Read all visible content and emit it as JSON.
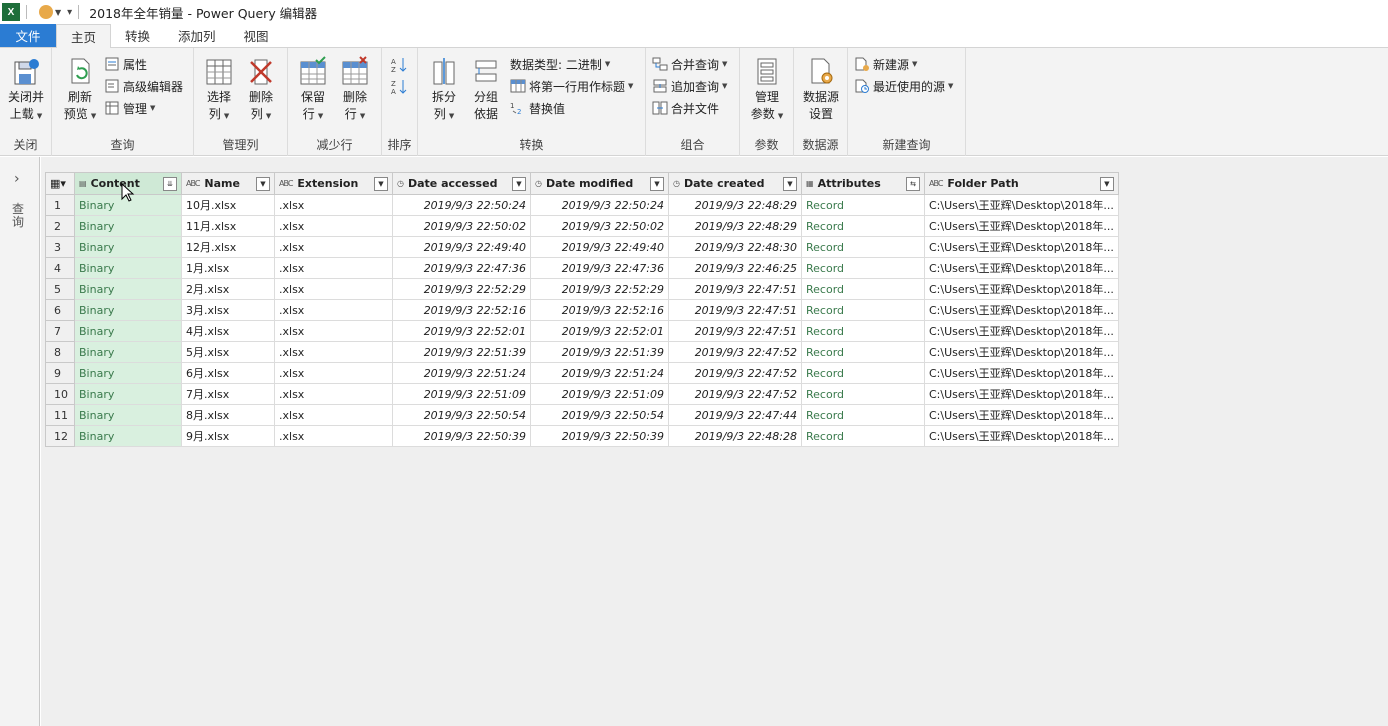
{
  "window": {
    "excel_icon": "X",
    "title": "2018年全年销量 - Power Query 编辑器"
  },
  "tabs": [
    "文件",
    "主页",
    "转换",
    "添加列",
    "视图"
  ],
  "ribbon": {
    "close": {
      "label1": "关闭并",
      "label2": "上载",
      "group": "关闭"
    },
    "query": {
      "refresh1": "刷新",
      "refresh2": "预览",
      "properties": "属性",
      "advanced_editor": "高级编辑器",
      "manage": "管理",
      "group": "查询"
    },
    "manage_columns": {
      "choose1": "选择",
      "choose2": "列",
      "remove1": "删除",
      "remove2": "列",
      "group": "管理列"
    },
    "reduce_rows": {
      "keep1": "保留",
      "keep2": "行",
      "remove1": "删除",
      "remove2": "行",
      "group": "减少行"
    },
    "sort": {
      "group": "排序"
    },
    "transform": {
      "split1": "拆分",
      "split2": "列",
      "groupby1": "分组",
      "groupby2": "依据",
      "data_type": "数据类型: 二进制",
      "first_row_header": "将第一行用作标题",
      "replace_values": "替换值",
      "group": "转换"
    },
    "combine": {
      "merge": "合并查询",
      "append": "追加查询",
      "combine_files": "合并文件",
      "group": "组合"
    },
    "parameters": {
      "manage1": "管理",
      "manage2": "参数",
      "group": "参数"
    },
    "datasource": {
      "settings1": "数据源",
      "settings2": "设置",
      "group": "数据源"
    },
    "new_query": {
      "new_source": "新建源",
      "recent_sources": "最近使用的源",
      "group": "新建查询"
    }
  },
  "nav": {
    "label": "查询"
  },
  "grid": {
    "columns": [
      "Content",
      "Name",
      "Extension",
      "Date accessed",
      "Date modified",
      "Date created",
      "Attributes",
      "Folder Path"
    ],
    "rows": [
      [
        "1",
        "Binary",
        "10月.xlsx",
        ".xlsx",
        "2019/9/3 22:50:24",
        "2019/9/3 22:50:24",
        "2019/9/3 22:48:29",
        "Record",
        "C:\\Users\\王亚辉\\Desktop\\2018年..."
      ],
      [
        "2",
        "Binary",
        "11月.xlsx",
        ".xlsx",
        "2019/9/3 22:50:02",
        "2019/9/3 22:50:02",
        "2019/9/3 22:48:29",
        "Record",
        "C:\\Users\\王亚辉\\Desktop\\2018年..."
      ],
      [
        "3",
        "Binary",
        "12月.xlsx",
        ".xlsx",
        "2019/9/3 22:49:40",
        "2019/9/3 22:49:40",
        "2019/9/3 22:48:30",
        "Record",
        "C:\\Users\\王亚辉\\Desktop\\2018年..."
      ],
      [
        "4",
        "Binary",
        "1月.xlsx",
        ".xlsx",
        "2019/9/3 22:47:36",
        "2019/9/3 22:47:36",
        "2019/9/3 22:46:25",
        "Record",
        "C:\\Users\\王亚辉\\Desktop\\2018年..."
      ],
      [
        "5",
        "Binary",
        "2月.xlsx",
        ".xlsx",
        "2019/9/3 22:52:29",
        "2019/9/3 22:52:29",
        "2019/9/3 22:47:51",
        "Record",
        "C:\\Users\\王亚辉\\Desktop\\2018年..."
      ],
      [
        "6",
        "Binary",
        "3月.xlsx",
        ".xlsx",
        "2019/9/3 22:52:16",
        "2019/9/3 22:52:16",
        "2019/9/3 22:47:51",
        "Record",
        "C:\\Users\\王亚辉\\Desktop\\2018年..."
      ],
      [
        "7",
        "Binary",
        "4月.xlsx",
        ".xlsx",
        "2019/9/3 22:52:01",
        "2019/9/3 22:52:01",
        "2019/9/3 22:47:51",
        "Record",
        "C:\\Users\\王亚辉\\Desktop\\2018年..."
      ],
      [
        "8",
        "Binary",
        "5月.xlsx",
        ".xlsx",
        "2019/9/3 22:51:39",
        "2019/9/3 22:51:39",
        "2019/9/3 22:47:52",
        "Record",
        "C:\\Users\\王亚辉\\Desktop\\2018年..."
      ],
      [
        "9",
        "Binary",
        "6月.xlsx",
        ".xlsx",
        "2019/9/3 22:51:24",
        "2019/9/3 22:51:24",
        "2019/9/3 22:47:52",
        "Record",
        "C:\\Users\\王亚辉\\Desktop\\2018年..."
      ],
      [
        "10",
        "Binary",
        "7月.xlsx",
        ".xlsx",
        "2019/9/3 22:51:09",
        "2019/9/3 22:51:09",
        "2019/9/3 22:47:52",
        "Record",
        "C:\\Users\\王亚辉\\Desktop\\2018年..."
      ],
      [
        "11",
        "Binary",
        "8月.xlsx",
        ".xlsx",
        "2019/9/3 22:50:54",
        "2019/9/3 22:50:54",
        "2019/9/3 22:47:44",
        "Record",
        "C:\\Users\\王亚辉\\Desktop\\2018年..."
      ],
      [
        "12",
        "Binary",
        "9月.xlsx",
        ".xlsx",
        "2019/9/3 22:50:39",
        "2019/9/3 22:50:39",
        "2019/9/3 22:48:28",
        "Record",
        "C:\\Users\\王亚辉\\Desktop\\2018年..."
      ]
    ]
  },
  "colors": {
    "file_tab": "#2b7cd3",
    "selected_column": "#d9f0df",
    "link_green": "#3a7a4c"
  }
}
